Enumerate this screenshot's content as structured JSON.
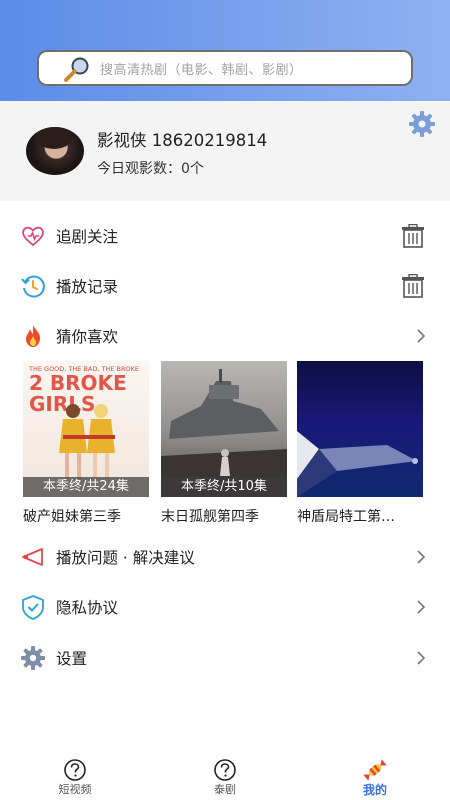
{
  "search": {
    "placeholder": "搜高清热剧（电影、韩剧、影剧）"
  },
  "profile": {
    "name": "影视侠 18620219814",
    "watch_today": "今日观影数：0个"
  },
  "menu": {
    "follow": "追剧关注",
    "history": "播放记录",
    "guess": "猜你喜欢",
    "feedback": "播放问题 · 解决建议",
    "privacy": "隐私协议",
    "settings": "设置"
  },
  "recommendations": [
    {
      "title": "破产姐妹第三季",
      "badge": "本季终/共24集",
      "poster_text_top": "THE GOOD, THE BAD, THE BROKE",
      "poster_text_main": "2 BROKE GIRLS"
    },
    {
      "title": "末日孤舰第四季",
      "badge": "本季终/共10集"
    },
    {
      "title": "神盾局特工第…",
      "badge": ""
    }
  ],
  "tabbar": [
    {
      "label": "短视频",
      "icon": "question-circle-icon"
    },
    {
      "label": "泰剧",
      "icon": "question-circle-icon"
    },
    {
      "label": "我的",
      "icon": "candy-icon"
    }
  ],
  "colors": {
    "accent": "#3a6fe0",
    "header_start": "#5b8ce6",
    "header_end": "#8fb1f3"
  }
}
